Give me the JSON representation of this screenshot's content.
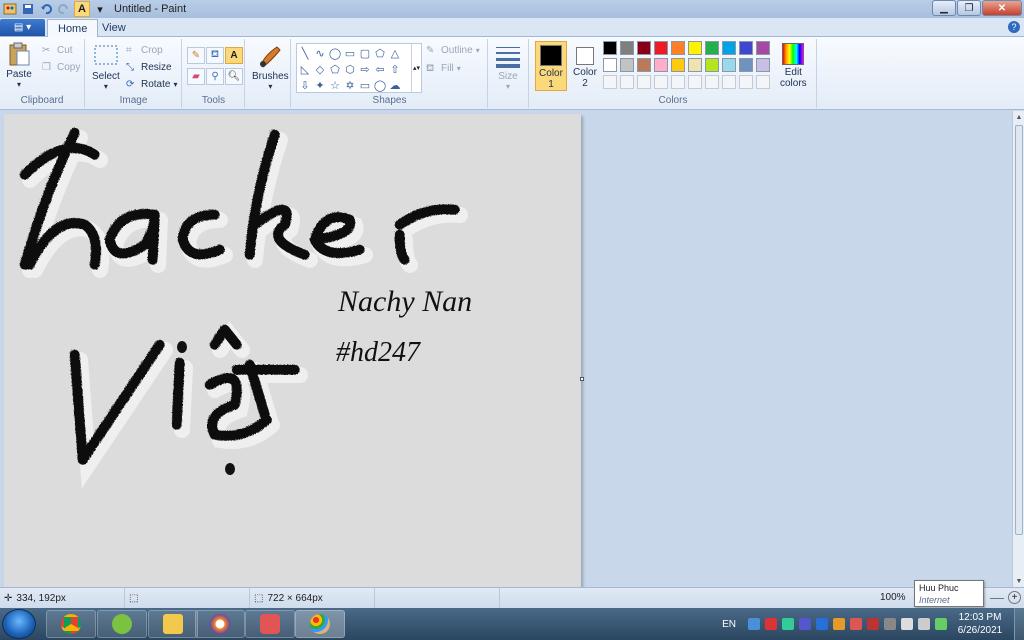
{
  "window": {
    "title": "Untitled - Paint"
  },
  "tabs": {
    "home": "Home",
    "view": "View"
  },
  "ribbon": {
    "clipboard": {
      "label": "Clipboard",
      "paste": "Paste",
      "cut": "Cut",
      "copy": "Copy"
    },
    "image": {
      "label": "Image",
      "select": "Select",
      "crop": "Crop",
      "resize": "Resize",
      "rotate": "Rotate"
    },
    "tools": {
      "label": "Tools",
      "text_tool": "A"
    },
    "brushes": {
      "label": "Brushes"
    },
    "shapes": {
      "label": "Shapes",
      "outline": "Outline",
      "fill": "Fill"
    },
    "size": {
      "label": "Size"
    },
    "colors": {
      "label": "Colors",
      "color1_label": "Color",
      "color1_num": "1",
      "color2_label": "Color",
      "color2_num": "2",
      "edit_label": "Edit",
      "edit_label2": "colors",
      "color1": "#000000",
      "color2": "#ffffff",
      "palette_row1": [
        "#000000",
        "#7f7f7f",
        "#880015",
        "#ed1c24",
        "#ff7f27",
        "#fff200",
        "#22b14c",
        "#00a2e8",
        "#3f48cc",
        "#a349a4"
      ],
      "palette_row2": [
        "#ffffff",
        "#c3c3c3",
        "#b97a57",
        "#ffaec9",
        "#ffc90e",
        "#efe4b0",
        "#b5e61d",
        "#99d9ea",
        "#7092be",
        "#c8bfe7"
      ]
    }
  },
  "canvas": {
    "text1": "Nachy Nan",
    "text2": "#hd247"
  },
  "status": {
    "cursor_pos": "334, 192px",
    "image_size": "722 × 664px",
    "zoom": "100%"
  },
  "tooltip": {
    "title": "Huu Phuc",
    "subtitle": "Internet access"
  },
  "taskbar": {
    "language": "EN",
    "time": "12:03 PM",
    "date": "6/26/2021"
  }
}
